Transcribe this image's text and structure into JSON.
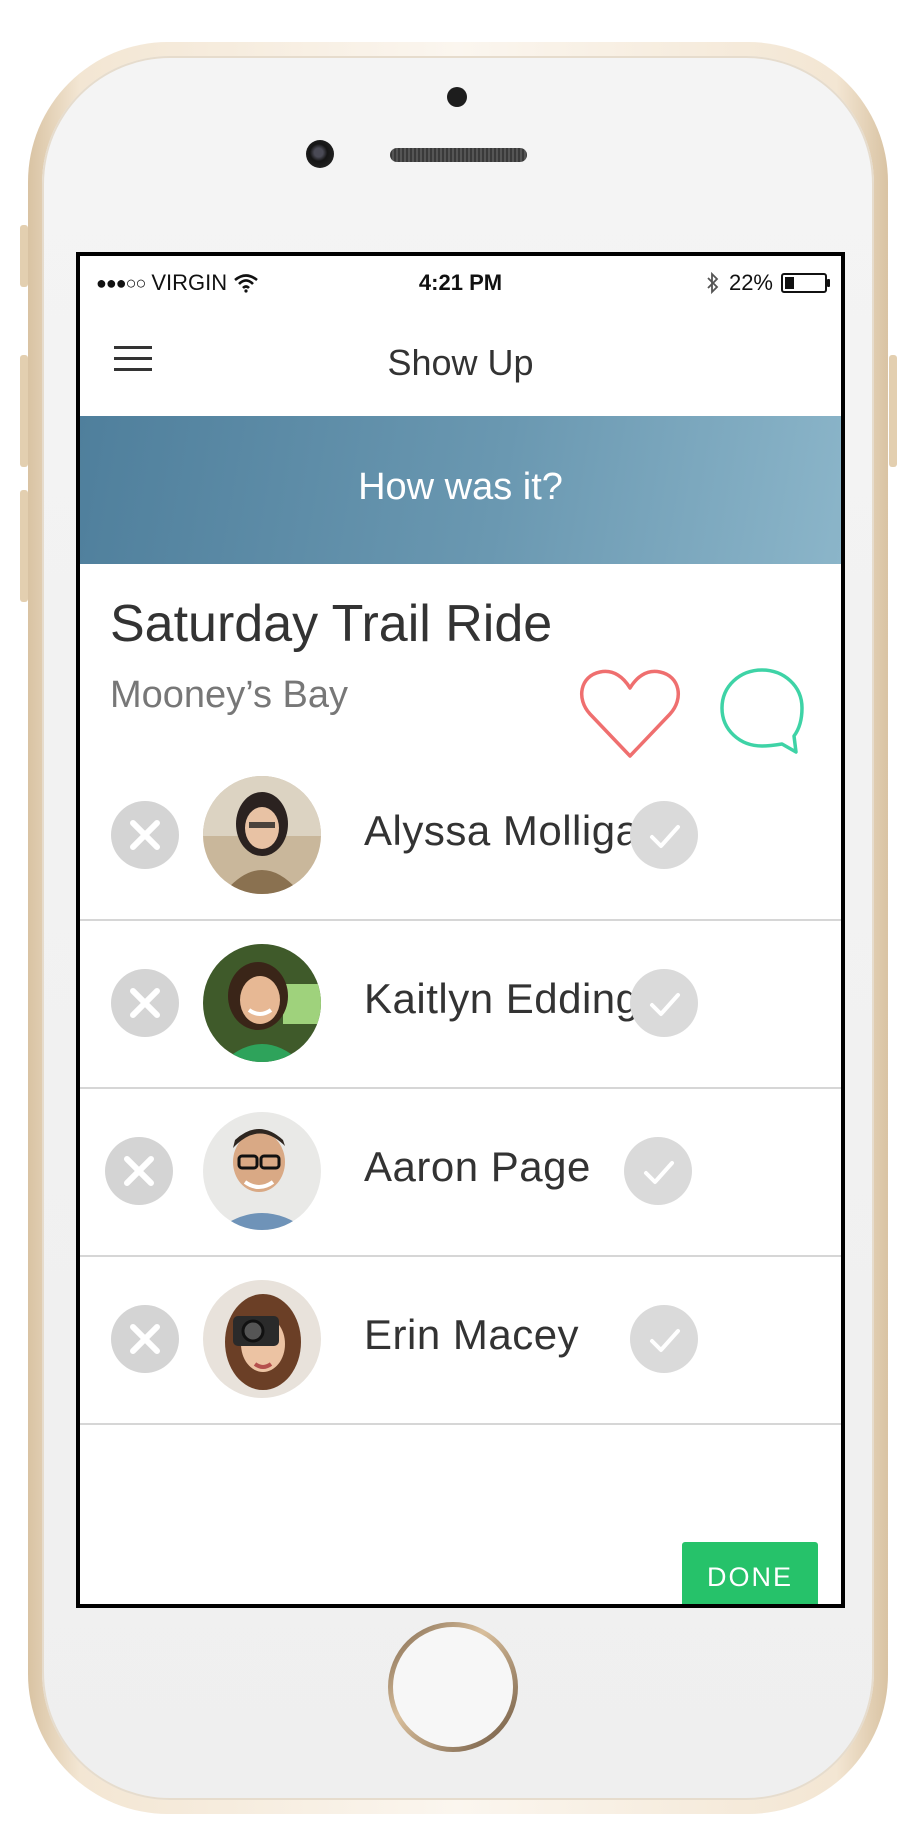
{
  "status_bar": {
    "carrier": "VIRGIN",
    "signal_dots": "●●●○○",
    "time": "4:21 PM",
    "battery_percent": "22%",
    "battery_level": 0.22
  },
  "app": {
    "title": "Show Up"
  },
  "banner": {
    "text": "How was it?",
    "gradient_start": "#4f7f9c",
    "gradient_end": "#8bb5c9"
  },
  "event": {
    "title": "Saturday Trail Ride",
    "location": "Mooney’s Bay"
  },
  "attendees": [
    {
      "name": "Alyssa Molligan"
    },
    {
      "name": "Kaitlyn Eddington"
    },
    {
      "name": "Aaron Page"
    },
    {
      "name": "Erin Macey"
    }
  ],
  "actions": {
    "done_label": "DONE"
  },
  "colors": {
    "heart": "#ef6f6f",
    "chat": "#3ed3a6",
    "done": "#26c26a"
  }
}
